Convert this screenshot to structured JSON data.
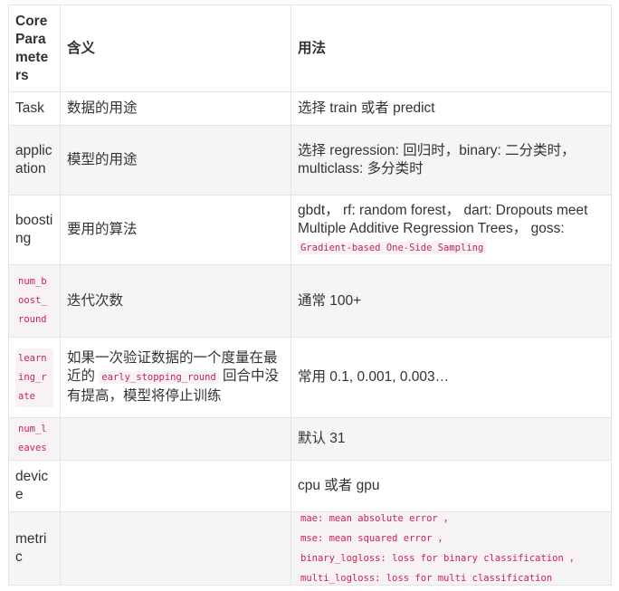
{
  "headers": [
    "Core Parameters",
    "含义",
    "用法"
  ],
  "rows": [
    {
      "param": "Task",
      "meaning": "数据的用途",
      "usage": "选择 train 或者 predict"
    },
    {
      "param": "application",
      "meaning": "模型的用途",
      "usage_a": "选择 regression: 回归时，binary: 二分类时，",
      "usage_b": "multiclass: 多分类时"
    },
    {
      "param": "boosting",
      "meaning": "要用的算法",
      "usage": "gbdt， rf: random forest， dart: Dropouts meet Multiple Additive Regression Trees， goss: ",
      "usage_code": "Gradient-based One-Side Sampling"
    },
    {
      "param_code": "num_boost_round",
      "meaning": "迭代次数",
      "usage": "通常 100+"
    },
    {
      "param_code": "learning_rate",
      "meaning_a": "如果一次验证数据的一个度量在最近的 ",
      "meaning_code": "early_stopping_round",
      "meaning_b": " 回合中没有提高，模型将停止训练",
      "usage": "常用 0.1, 0.001, 0.003…"
    },
    {
      "param_code": "num_leaves",
      "meaning": "",
      "usage": "默认 31"
    },
    {
      "param": "device",
      "meaning": "",
      "usage": "cpu 或者 gpu"
    },
    {
      "param": "metric",
      "meaning": "",
      "usage_lines": [
        "mae: mean absolute error ，",
        "mse: mean squared error ，",
        "binary_logloss: loss for binary classification ，",
        "multi_logloss: loss for multi classification"
      ]
    }
  ]
}
